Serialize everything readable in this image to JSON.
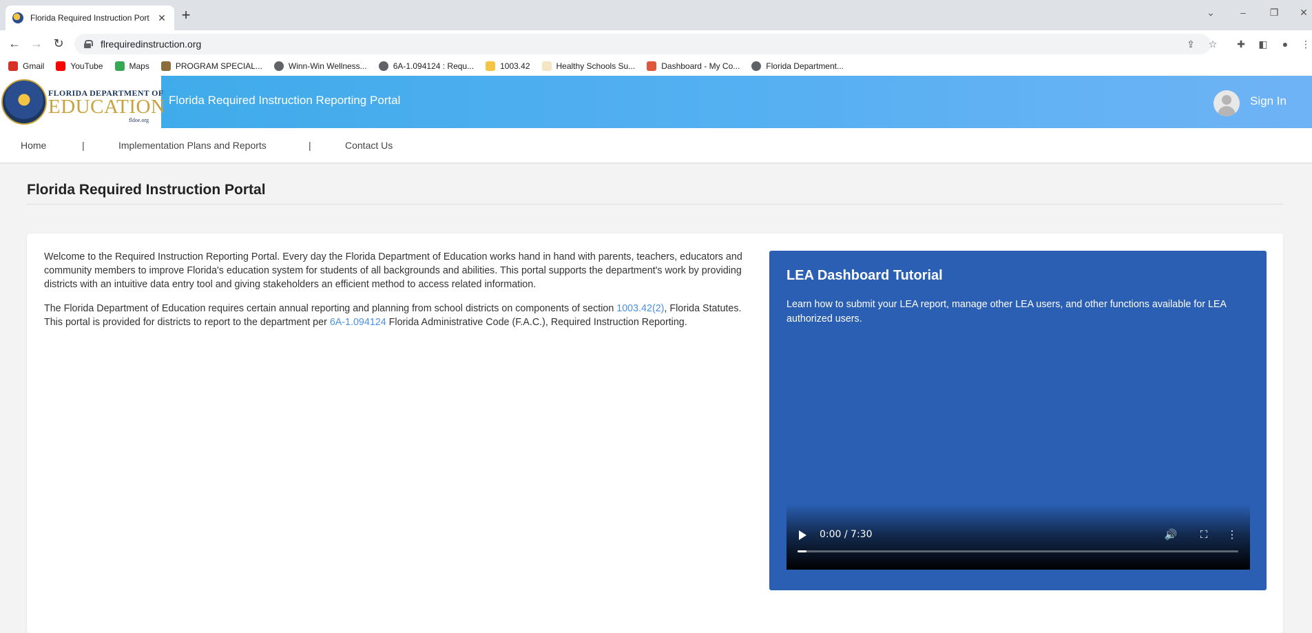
{
  "browser": {
    "tab_title": "Florida Required Instruction Port",
    "url": "flrequiredinstruction.org",
    "bookmarks": [
      {
        "label": "Gmail",
        "icon": "gmail-icon",
        "color": "#d93025"
      },
      {
        "label": "YouTube",
        "icon": "youtube-icon",
        "color": "#ff0000"
      },
      {
        "label": "Maps",
        "icon": "maps-icon",
        "color": "#34a853"
      },
      {
        "label": "PROGRAM SPECIAL...",
        "icon": "site-icon",
        "color": "#8a6d3b"
      },
      {
        "label": "Winn-Win Wellness...",
        "icon": "globe-icon",
        "color": "#5f6368"
      },
      {
        "label": "6A-1.094124 : Requ...",
        "icon": "globe-icon",
        "color": "#5f6368"
      },
      {
        "label": "1003.42",
        "icon": "site-icon",
        "color": "#f4c542"
      },
      {
        "label": "Healthy Schools Su...",
        "icon": "site-icon",
        "color": "#f4e6c3"
      },
      {
        "label": "Dashboard - My Co...",
        "icon": "site-icon",
        "color": "#e0583c"
      },
      {
        "label": "Florida Department...",
        "icon": "globe-icon",
        "color": "#5f6368"
      }
    ]
  },
  "header": {
    "logo_top": "FLORIDA DEPARTMENT OF",
    "logo_big": "EDUCATION",
    "logo_small": "fldoe.org",
    "site_title": "Florida Required Instruction Reporting Portal",
    "sign_in": "Sign In"
  },
  "nav": {
    "home": "Home",
    "sep": "|",
    "plans": "Implementation Plans and Reports",
    "contact": "Contact Us"
  },
  "main": {
    "page_title": "Florida Required Instruction Portal",
    "para1": "Welcome to the Required Instruction Reporting Portal. Every day the Florida Department of Education works hand in hand with parents, teachers, educators and community members to improve Florida's education system for students of all backgrounds and abilities. This portal supports the department's work by providing districts with an intuitive data entry tool and giving stakeholders an efficient method to access related information.",
    "para2_a": "The Florida Department of Education requires certain annual reporting and planning from school districts on components of section ",
    "para2_link1": "1003.42(2)",
    "para2_b": ", Florida Statutes. This portal is provided for districts to report to the department per ",
    "para2_link2": "6A-1.094124",
    "para2_c": " Florida Administrative Code (F.A.C.), Required Instruction Reporting."
  },
  "tutorial": {
    "title": "LEA Dashboard Tutorial",
    "description": "Learn how to submit your LEA report, manage other LEA users, and other functions available for LEA authorized users.",
    "video_time": "0:00 / 7:30",
    "video_progress": 0.02
  },
  "colors": {
    "header_gradient_start": "#3aaae8",
    "tutorial_bg": "#2a5fb3",
    "link": "#4a90e2"
  }
}
